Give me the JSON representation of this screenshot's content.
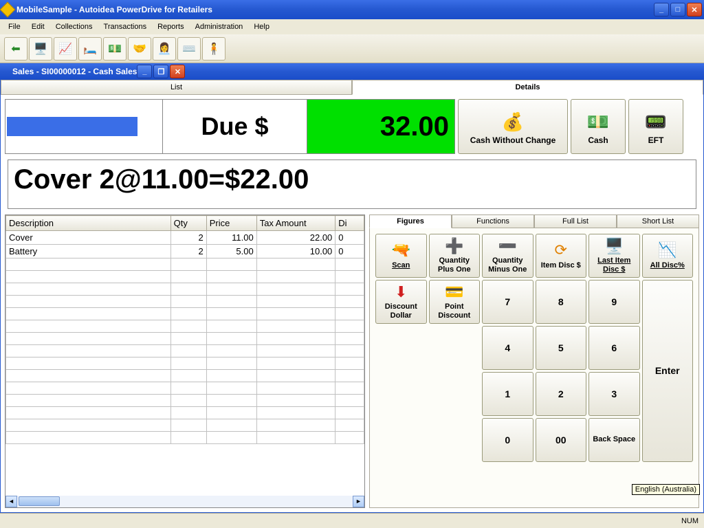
{
  "main_window": {
    "title": "MobileSample - Autoidea PowerDrive for Retailers"
  },
  "menu": {
    "file": "File",
    "edit": "Edit",
    "collections": "Collections",
    "transactions": "Transactions",
    "reports": "Reports",
    "administration": "Administration",
    "help": "Help"
  },
  "child_window": {
    "title": "Sales - SI00000012 - Cash Sales"
  },
  "top_tabs": {
    "list": "List",
    "details": "Details"
  },
  "due": {
    "label": "Due $",
    "amount": "32.00"
  },
  "pay_buttons": {
    "cash_no_change": "Cash Without Change",
    "cash": "Cash",
    "eft": "EFT"
  },
  "item_display": "Cover 2@11.00=$22.00",
  "table": {
    "headers": {
      "desc": "Description",
      "qty": "Qty",
      "price": "Price",
      "tax_amount": "Tax Amount",
      "di": "Di"
    },
    "rows": [
      {
        "desc": "Cover",
        "qty": "2",
        "price": "11.00",
        "tax_amount": "22.00",
        "di": "0"
      },
      {
        "desc": "Battery",
        "qty": "2",
        "price": "5.00",
        "tax_amount": "10.00",
        "di": "0"
      }
    ]
  },
  "sub_tabs": {
    "figures": "Figures",
    "functions": "Functions",
    "full_list": "Full List",
    "short_list": "Short List"
  },
  "keypad": {
    "scan": "Scan",
    "qty_plus": "Quantity Plus One",
    "qty_minus": "Quantity Minus One",
    "item_disc_dollar": "Item Disc $",
    "last_item_disc_dollar": "Last Item Disc $",
    "all_disc_pct": "All Disc%",
    "discount_dollar": "Discount Dollar",
    "point_discount": "Point Discount",
    "k7": "7",
    "k8": "8",
    "k9": "9",
    "k4": "4",
    "k5": "5",
    "k6": "6",
    "k1": "1",
    "k2": "2",
    "k3": "3",
    "k0": "0",
    "k00": "00",
    "backspace": "Back Space",
    "enter": "Enter"
  },
  "status": {
    "num": "NUM",
    "lang": "English (Australia)"
  }
}
